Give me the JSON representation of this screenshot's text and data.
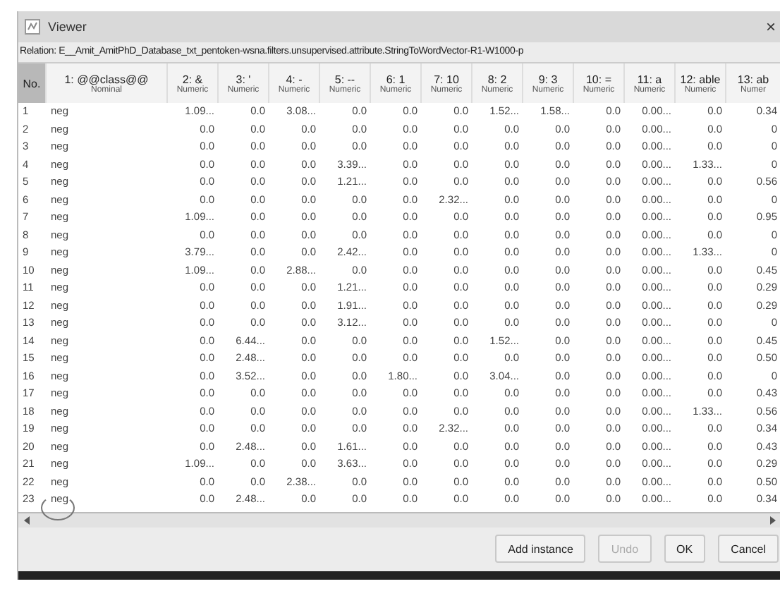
{
  "window": {
    "title": "Viewer",
    "close": "×"
  },
  "relation": "Relation: E__Amit_AmitPhD_Database_txt_pentoken-wsna.filters.unsupervised.attribute.StringToWordVector-R1-W1000-p",
  "columns": [
    {
      "name": "No.",
      "selected": true
    },
    {
      "name": "1: @@class@@",
      "type": "Nominal",
      "selected": false
    },
    {
      "name": "2: &",
      "type": "Numeric",
      "selected": false
    },
    {
      "name": "3: '",
      "type": "Numeric",
      "selected": false
    },
    {
      "name": "4: -",
      "type": "Numeric",
      "selected": false
    },
    {
      "name": "5: --",
      "type": "Numeric",
      "selected": false
    },
    {
      "name": "6: 1",
      "type": "Numeric",
      "selected": false
    },
    {
      "name": "7: 10",
      "type": "Numeric",
      "selected": false
    },
    {
      "name": "8: 2",
      "type": "Numeric",
      "selected": false
    },
    {
      "name": "9: 3",
      "type": "Numeric",
      "selected": false
    },
    {
      "name": "10: =",
      "type": "Numeric",
      "selected": false
    },
    {
      "name": "11: a",
      "type": "Numeric",
      "selected": false
    },
    {
      "name": "12: able",
      "type": "Numeric",
      "selected": false
    },
    {
      "name": "13: ab",
      "type": "Numer",
      "selected": false
    }
  ],
  "rows": [
    [
      "1",
      "neg",
      "1.09...",
      "0.0",
      "3.08...",
      "0.0",
      "0.0",
      "0.0",
      "1.52...",
      "1.58...",
      "0.0",
      "0.00...",
      "0.0",
      "0.34"
    ],
    [
      "2",
      "neg",
      "0.0",
      "0.0",
      "0.0",
      "0.0",
      "0.0",
      "0.0",
      "0.0",
      "0.0",
      "0.0",
      "0.00...",
      "0.0",
      "0"
    ],
    [
      "3",
      "neg",
      "0.0",
      "0.0",
      "0.0",
      "0.0",
      "0.0",
      "0.0",
      "0.0",
      "0.0",
      "0.0",
      "0.00...",
      "0.0",
      "0"
    ],
    [
      "4",
      "neg",
      "0.0",
      "0.0",
      "0.0",
      "3.39...",
      "0.0",
      "0.0",
      "0.0",
      "0.0",
      "0.0",
      "0.00...",
      "1.33...",
      "0"
    ],
    [
      "5",
      "neg",
      "0.0",
      "0.0",
      "0.0",
      "1.21...",
      "0.0",
      "0.0",
      "0.0",
      "0.0",
      "0.0",
      "0.00...",
      "0.0",
      "0.56"
    ],
    [
      "6",
      "neg",
      "0.0",
      "0.0",
      "0.0",
      "0.0",
      "0.0",
      "2.32...",
      "0.0",
      "0.0",
      "0.0",
      "0.00...",
      "0.0",
      "0"
    ],
    [
      "7",
      "neg",
      "1.09...",
      "0.0",
      "0.0",
      "0.0",
      "0.0",
      "0.0",
      "0.0",
      "0.0",
      "0.0",
      "0.00...",
      "0.0",
      "0.95"
    ],
    [
      "8",
      "neg",
      "0.0",
      "0.0",
      "0.0",
      "0.0",
      "0.0",
      "0.0",
      "0.0",
      "0.0",
      "0.0",
      "0.00...",
      "0.0",
      "0"
    ],
    [
      "9",
      "neg",
      "3.79...",
      "0.0",
      "0.0",
      "2.42...",
      "0.0",
      "0.0",
      "0.0",
      "0.0",
      "0.0",
      "0.00...",
      "1.33...",
      "0"
    ],
    [
      "10",
      "neg",
      "1.09...",
      "0.0",
      "2.88...",
      "0.0",
      "0.0",
      "0.0",
      "0.0",
      "0.0",
      "0.0",
      "0.00...",
      "0.0",
      "0.45"
    ],
    [
      "11",
      "neg",
      "0.0",
      "0.0",
      "0.0",
      "1.21...",
      "0.0",
      "0.0",
      "0.0",
      "0.0",
      "0.0",
      "0.00...",
      "0.0",
      "0.29"
    ],
    [
      "12",
      "neg",
      "0.0",
      "0.0",
      "0.0",
      "1.91...",
      "0.0",
      "0.0",
      "0.0",
      "0.0",
      "0.0",
      "0.00...",
      "0.0",
      "0.29"
    ],
    [
      "13",
      "neg",
      "0.0",
      "0.0",
      "0.0",
      "3.12...",
      "0.0",
      "0.0",
      "0.0",
      "0.0",
      "0.0",
      "0.00...",
      "0.0",
      "0"
    ],
    [
      "14",
      "neg",
      "0.0",
      "6.44...",
      "0.0",
      "0.0",
      "0.0",
      "0.0",
      "1.52...",
      "0.0",
      "0.0",
      "0.00...",
      "0.0",
      "0.45"
    ],
    [
      "15",
      "neg",
      "0.0",
      "2.48...",
      "0.0",
      "0.0",
      "0.0",
      "0.0",
      "0.0",
      "0.0",
      "0.0",
      "0.00...",
      "0.0",
      "0.50"
    ],
    [
      "16",
      "neg",
      "0.0",
      "3.52...",
      "0.0",
      "0.0",
      "1.80...",
      "0.0",
      "3.04...",
      "0.0",
      "0.0",
      "0.00...",
      "0.0",
      "0"
    ],
    [
      "17",
      "neg",
      "0.0",
      "0.0",
      "0.0",
      "0.0",
      "0.0",
      "0.0",
      "0.0",
      "0.0",
      "0.0",
      "0.00...",
      "0.0",
      "0.43"
    ],
    [
      "18",
      "neg",
      "0.0",
      "0.0",
      "0.0",
      "0.0",
      "0.0",
      "0.0",
      "0.0",
      "0.0",
      "0.0",
      "0.00...",
      "1.33...",
      "0.56"
    ],
    [
      "19",
      "neg",
      "0.0",
      "0.0",
      "0.0",
      "0.0",
      "0.0",
      "2.32...",
      "0.0",
      "0.0",
      "0.0",
      "0.00...",
      "0.0",
      "0.34"
    ],
    [
      "20",
      "neg",
      "0.0",
      "2.48...",
      "0.0",
      "1.61...",
      "0.0",
      "0.0",
      "0.0",
      "0.0",
      "0.0",
      "0.00...",
      "0.0",
      "0.43"
    ],
    [
      "21",
      "neg",
      "1.09...",
      "0.0",
      "0.0",
      "3.63...",
      "0.0",
      "0.0",
      "0.0",
      "0.0",
      "0.0",
      "0.00...",
      "0.0",
      "0.29"
    ],
    [
      "22",
      "neg",
      "0.0",
      "0.0",
      "2.38...",
      "0.0",
      "0.0",
      "0.0",
      "0.0",
      "0.0",
      "0.0",
      "0.00...",
      "0.0",
      "0.50"
    ],
    [
      "23",
      "neg",
      "0.0",
      "2.48...",
      "0.0",
      "0.0",
      "0.0",
      "0.0",
      "0.0",
      "0.0",
      "0.0",
      "0.00...",
      "0.0",
      "0.34"
    ]
  ],
  "buttons": [
    {
      "label": "Add instance",
      "disabled": false
    },
    {
      "label": "Undo",
      "disabled": true
    },
    {
      "label": "OK",
      "disabled": false
    },
    {
      "label": "Cancel",
      "disabled": false
    }
  ]
}
